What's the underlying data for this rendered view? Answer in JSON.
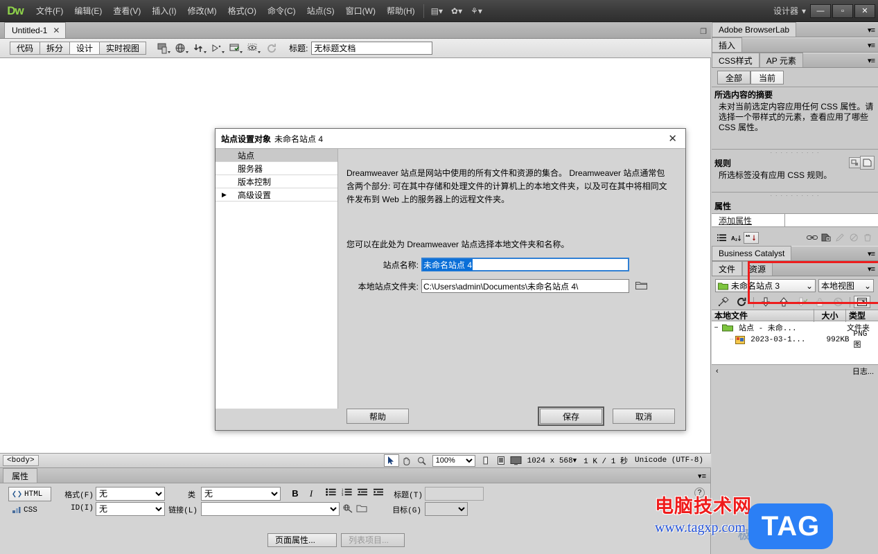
{
  "titlebar": {
    "logo": "Dw",
    "menus": [
      "文件(F)",
      "编辑(E)",
      "查看(V)",
      "插入(I)",
      "修改(M)",
      "格式(O)",
      "命令(C)",
      "站点(S)",
      "窗口(W)",
      "帮助(H)"
    ],
    "workspace": "设计器",
    "workspace_caret": "▾",
    "layout_icon": "▤▾",
    "gear_icon": "✿▾",
    "site_icon": "⚘▾",
    "minimize": "—",
    "maximize": "▫",
    "close": "✕"
  },
  "doctab": {
    "label": "Untitled-1",
    "close": "✕",
    "restore": "❐"
  },
  "toolbar": {
    "views": [
      {
        "label": "代码",
        "active": false
      },
      {
        "label": "拆分",
        "active": false
      },
      {
        "label": "设计",
        "active": true
      },
      {
        "label": "实时视图",
        "active": false
      }
    ],
    "icons": [
      "multiscreen-icon",
      "globe-icon",
      "file-transfer-icon",
      "live-preview-icon",
      "validation-icon",
      "visual-aids-icon",
      "refresh-icon"
    ],
    "title_label": "标题:",
    "title_value": "无标题文档"
  },
  "statusbar": {
    "tag": "<body>",
    "select_icon": "➤",
    "hand_icon": "✋",
    "zoom_icon": "🔍",
    "zoom_value": "100%",
    "window_sizes": [
      "phone-size-icon",
      "tablet-size-icon",
      "desktop-size-icon"
    ],
    "dimensions": "1024 x 568",
    "dimensions_caret": "▾",
    "download": "1 K / 1 秒",
    "encoding": "Unicode (UTF-8)"
  },
  "properties": {
    "tab": "属性",
    "panel_menu": "▾≡",
    "html_button": "HTML",
    "css_button": "CSS",
    "format_label": "格式(F)",
    "format_value": "无",
    "id_label": "ID(I)",
    "id_value": "无",
    "class_label": "类",
    "class_value": "无",
    "link_label": "链接(L)",
    "link_value": "",
    "bold": "B",
    "italic": "I",
    "list_ul": "list-unordered-icon",
    "list_ol": "list-ordered-icon",
    "outdent": "outdent-icon",
    "indent": "indent-icon",
    "title_label": "标题(T)",
    "title_value": "",
    "target_label": "目标(G)",
    "target_value": "",
    "page_properties": "页面属性...",
    "list_item": "列表项目...",
    "help_icon": "?"
  },
  "dock": {
    "browserlab": {
      "title": "Adobe BrowserLab",
      "menu": "▾≡"
    },
    "insert": {
      "title": "插入",
      "menu": "▾≡"
    },
    "css_panel": {
      "tabs": [
        {
          "label": "CSS样式",
          "active": true
        },
        {
          "label": "AP 元素",
          "active": false
        }
      ],
      "menu": "▾≡",
      "toggles": [
        {
          "label": "全部",
          "active": false
        },
        {
          "label": "当前",
          "active": true
        }
      ],
      "summary_title": "所选内容的摘要",
      "summary_text": "未对当前选定内容应用任何 CSS 属性。请选择一个带样式的元素，查看应用了哪些 CSS 属性。",
      "rules_title": "规则",
      "rules_text": "所选标签没有应用 CSS 规则。",
      "props_title": "属性",
      "add_property": "添加属性",
      "footer_icons": [
        "category-view-icon",
        "alphabetical-view-icon",
        "set-properties-icon",
        "attach-stylesheet-icon",
        "new-css-rule-icon",
        "edit-rule-icon",
        "disable-property-icon",
        "delete-property-icon"
      ]
    },
    "business_catalyst": {
      "title": "Business Catalyst",
      "menu": "▾≡"
    },
    "files_panel": {
      "tabs": [
        {
          "label": "文件",
          "active": true
        },
        {
          "label": "资源",
          "active": false
        }
      ],
      "menu": "▾≡",
      "site_select": "未命名站点 3",
      "site_icon": "folder-icon",
      "view_select": "本地视图",
      "caret": "⌄",
      "toolbar_icons": [
        "connect-icon",
        "refresh-icon",
        "get-files-icon",
        "put-files-icon",
        "check-out-icon",
        "check-in-icon",
        "synchronize-icon",
        "expand-icon"
      ],
      "columns": [
        "本地文件",
        "大小",
        "类型"
      ],
      "rows": [
        {
          "expander": "−",
          "icon": "folder-icon",
          "name": "站点 - 未命...",
          "size": "",
          "type": "文件夹",
          "indent": 0
        },
        {
          "expander": "",
          "icon": "image-file-icon",
          "name": "2023-03-1...",
          "size": "992KB",
          "type": "PNG 图",
          "indent": 1
        }
      ]
    },
    "log_label": "日志..."
  },
  "dialog": {
    "title": "站点设置对象",
    "title_name": "未命名站点 4",
    "close": "✕",
    "nav": [
      {
        "label": "站点",
        "selected": true,
        "arrow": ""
      },
      {
        "label": "服务器",
        "selected": false,
        "arrow": ""
      },
      {
        "label": "版本控制",
        "selected": false,
        "arrow": ""
      },
      {
        "label": "高级设置",
        "selected": false,
        "arrow": "▶"
      }
    ],
    "description": "Dreamweaver 站点是网站中使用的所有文件和资源的集合。 Dreamweaver 站点通常包含两个部分: 可在其中存储和处理文件的计算机上的本地文件夹，以及可在其中将相同文件发布到 Web 上的服务器上的远程文件夹。",
    "subtitle": "您可以在此处为 Dreamweaver 站点选择本地文件夹和名称。",
    "site_name_label": "站点名称:",
    "site_name_value": "未命名站点 4",
    "folder_label": "本地站点文件夹:",
    "folder_value": "C:\\Users\\admin\\Documents\\未命名站点 4\\",
    "browse_icon": "folder-browse-icon",
    "buttons": {
      "help": "帮助",
      "save": "保存",
      "cancel": "取消"
    }
  },
  "watermark": {
    "cn": "电脑技术网",
    "url": "www.tagxp.com",
    "logo": "TAG",
    "ghost": "极光下载"
  },
  "colors": {
    "accent_blue": "#0a6fd8",
    "focus_blue": "#2f7fd4",
    "red_highlight": "#ee1c1c",
    "logo_green": "#8fd34a",
    "watermark_red": "#ef1b1b",
    "watermark_blue": "#1f4fd8",
    "tag_blue": "#2b7ff5"
  }
}
